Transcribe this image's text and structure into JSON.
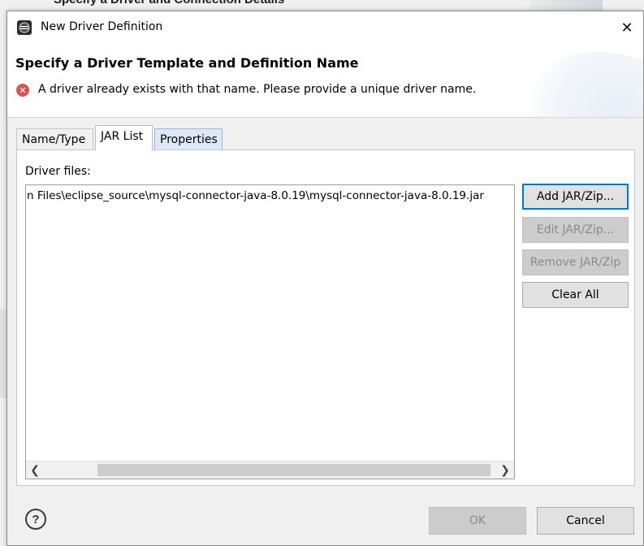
{
  "background_window": {
    "title": "Specify a Driver and Connection Details"
  },
  "window": {
    "title": "New Driver Definition",
    "close_glyph": "✕"
  },
  "header": {
    "title": "Specify a Driver Template and Definition Name",
    "error_message": "A driver already exists with that name. Please provide a unique driver name.",
    "error_icon_glyph": "✕"
  },
  "tabs": [
    {
      "label": "Name/Type",
      "active": false
    },
    {
      "label": "JAR List",
      "active": true
    },
    {
      "label": "Properties",
      "active": false
    }
  ],
  "jar_panel": {
    "label": "Driver files:",
    "items": [
      "n Files\\eclipse_source\\mysql-connector-java-8.0.19\\mysql-connector-java-8.0.19.jar"
    ],
    "scroll_left_glyph": "❮",
    "scroll_right_glyph": "❯",
    "buttons": {
      "add": "Add JAR/Zip...",
      "edit": "Edit JAR/Zip...",
      "remove": "Remove JAR/Zip",
      "clear": "Clear All"
    }
  },
  "footer": {
    "help_glyph": "?",
    "ok_label": "OK",
    "cancel_label": "Cancel"
  },
  "colors": {
    "error": "#d9534f",
    "focus_border": "#0078d7",
    "properties_tab": "#dde8f6"
  }
}
